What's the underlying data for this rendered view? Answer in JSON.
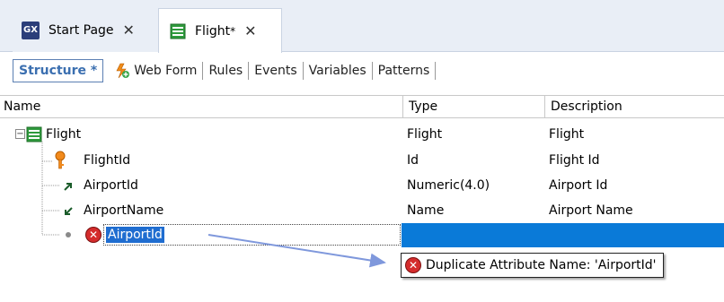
{
  "tabs": [
    {
      "label": "Start Page",
      "icon": "gx-logo-icon",
      "logo_text": "GX"
    },
    {
      "label": "Flight",
      "dirty_marker": "*",
      "icon": "transaction-icon"
    }
  ],
  "close_glyph": "✕",
  "subtabs": [
    {
      "label": "Structure *",
      "active": true
    },
    {
      "label": "Web Form",
      "icon": "web-form-icon"
    },
    {
      "label": "Rules"
    },
    {
      "label": "Events"
    },
    {
      "label": "Variables"
    },
    {
      "label": "Patterns"
    }
  ],
  "grid": {
    "columns": {
      "name": "Name",
      "type": "Type",
      "description": "Description"
    },
    "rows": [
      {
        "name": "Flight",
        "type": "Flight",
        "description": "Flight",
        "icon": "transaction-icon"
      },
      {
        "name": "FlightId",
        "type": "Id",
        "description": "Flight Id",
        "icon": "key-icon"
      },
      {
        "name": "AirportId",
        "type": "Numeric(4.0)",
        "description": "Airport Id",
        "icon": "foreign-key-icon"
      },
      {
        "name": "AirportName",
        "type": "Name",
        "description": "Airport Name",
        "icon": "inferred-attribute-icon"
      }
    ],
    "editing_row": {
      "value": "AirportId",
      "icon": "error-icon"
    },
    "expander_glyph": "−"
  },
  "tooltip": {
    "text": "Duplicate Attribute Name: 'AirportId'",
    "icon": "error-icon"
  },
  "colors": {
    "accent": "#3b6fb0",
    "selection": "#0a7ad8",
    "error": "#d42c2c"
  }
}
